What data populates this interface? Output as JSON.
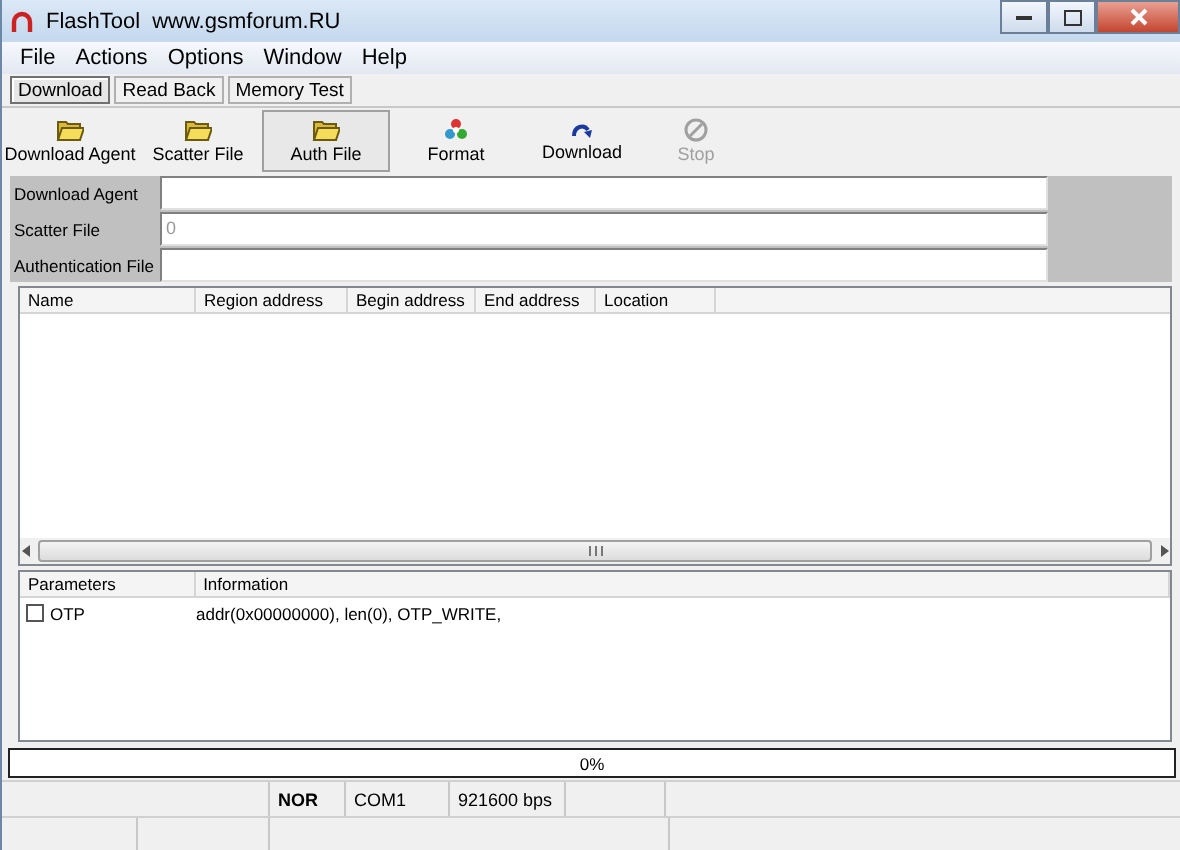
{
  "window": {
    "title": "FlashTool",
    "subtitle": "www.gsmforum.RU"
  },
  "menu": [
    "File",
    "Actions",
    "Options",
    "Window",
    "Help"
  ],
  "tabs": [
    {
      "label": "Download",
      "selected": true
    },
    {
      "label": "Read Back",
      "selected": false
    },
    {
      "label": "Memory Test",
      "selected": false
    }
  ],
  "toolbar": [
    {
      "label": "Download Agent",
      "kind": "folder",
      "pressed": false,
      "disabled": false
    },
    {
      "label": "Scatter File",
      "kind": "folder",
      "pressed": false,
      "disabled": false
    },
    {
      "label": "Auth File",
      "kind": "folder",
      "pressed": true,
      "disabled": false
    },
    {
      "label": "Format",
      "kind": "format",
      "pressed": false,
      "disabled": false
    },
    {
      "label": "Download",
      "kind": "download",
      "pressed": false,
      "disabled": false
    },
    {
      "label": "Stop",
      "kind": "stop",
      "pressed": false,
      "disabled": true
    }
  ],
  "fields": [
    {
      "label": "Download Agent"
    },
    {
      "label": "Scatter File",
      "value": "0"
    },
    {
      "label": "Authentication File"
    }
  ],
  "table": {
    "columns": [
      "Name",
      "Region address",
      "Begin address",
      "End address",
      "Location"
    ]
  },
  "parameters": {
    "columns": [
      "Parameters",
      "Information"
    ],
    "rows": [
      {
        "name": "OTP",
        "checked": false,
        "information": "addr(0x00000000), len(0), OTP_WRITE,"
      }
    ]
  },
  "progress": {
    "level": 0,
    "text": "0%"
  },
  "status_bar": {
    "cells": [
      "NOR",
      "COM1",
      "921600 bps"
    ]
  }
}
